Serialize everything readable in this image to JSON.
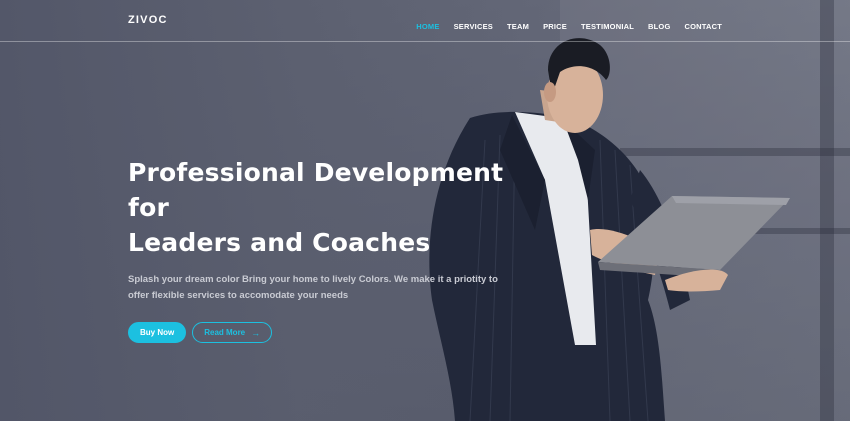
{
  "brand": {
    "logo": "ZIVOC"
  },
  "nav": {
    "items": [
      {
        "label": "HOME",
        "active": true
      },
      {
        "label": "SERVICES",
        "active": false
      },
      {
        "label": "TEAM",
        "active": false
      },
      {
        "label": "PRICE",
        "active": false
      },
      {
        "label": "TESTIMONIAL",
        "active": false
      },
      {
        "label": "BLOG",
        "active": false
      },
      {
        "label": "CONTACT",
        "active": false
      }
    ]
  },
  "hero": {
    "title_line1": "Professional Development for",
    "title_line2": "Leaders and Coaches",
    "description": "Splash your dream color Bring your home to lively Colors. We make it a priotity to offer flexible services to accomodate your needs",
    "primary_button": "Buy Now",
    "secondary_button": "Read More",
    "secondary_button_icon": "arrow-right-icon"
  },
  "colors": {
    "accent": "#1cc0e0",
    "text": "#ffffff"
  }
}
